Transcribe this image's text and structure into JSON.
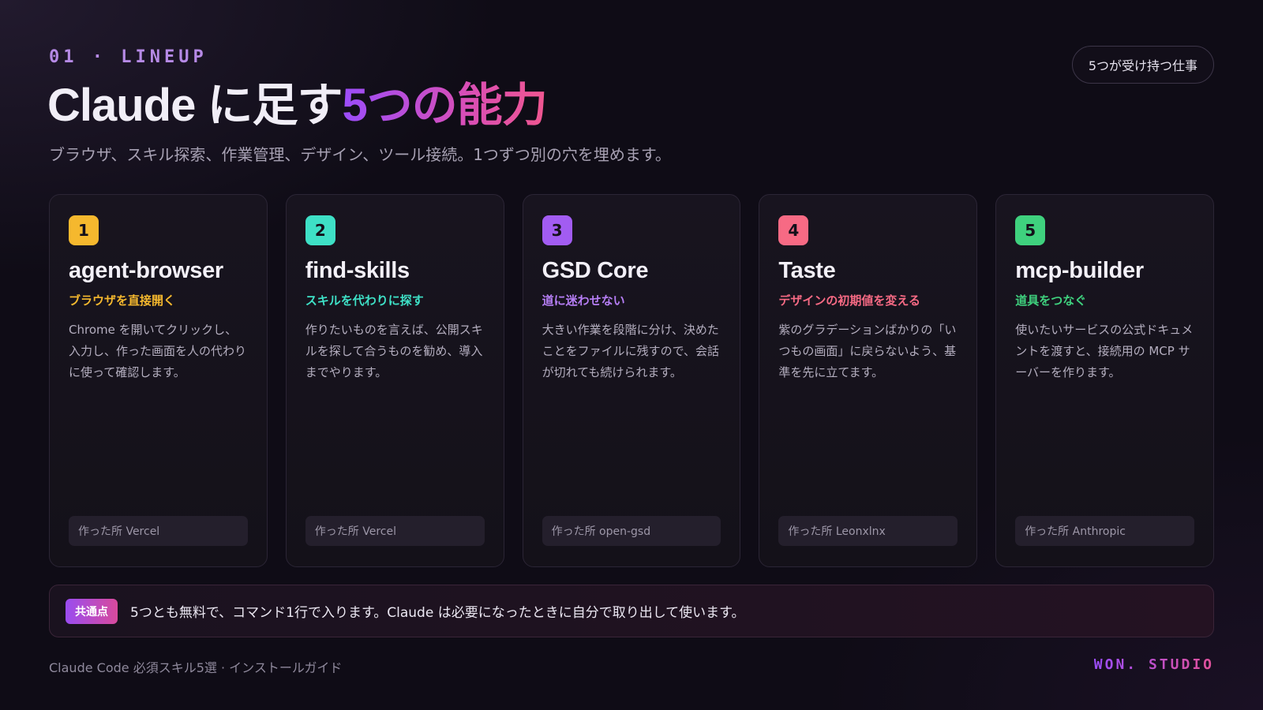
{
  "header": {
    "eyebrow": "01 · LINEUP",
    "title_plain": "Claude に足す",
    "title_accent": "5つの能力",
    "subtitle": "ブラウザ、スキル探索、作業管理、デザイン、ツール接続。1つずつ別の穴を埋めます。",
    "pill": "5つが受け持つ仕事"
  },
  "cards": [
    {
      "num": "1",
      "title": "agent-browser",
      "tag": "ブラウザを直接開く",
      "desc": "Chrome を開いてクリックし、入力し、作った画面を人の代わりに使って確認します。",
      "maker": "作った所 Vercel",
      "color": "#f5b82e"
    },
    {
      "num": "2",
      "title": "find-skills",
      "tag": "スキルを代わりに探す",
      "desc": "作りたいものを言えば、公開スキルを探して合うものを勧め、導入までやります。",
      "maker": "作った所 Vercel",
      "color": "#3ee0c6"
    },
    {
      "num": "3",
      "title": "GSD Core",
      "tag": "道に迷わせない",
      "desc": "大きい作業を段階に分け、決めたことをファイルに残すので、会話が切れても続けられます。",
      "maker": "作った所 open-gsd",
      "color": "#a25cf2"
    },
    {
      "num": "4",
      "title": "Taste",
      "tag": "デザインの初期値を変える",
      "desc": "紫のグラデーションばかりの「いつもの画面」に戻らないよう、基準を先に立てます。",
      "maker": "作った所 Leonxlnx",
      "color": "#f76a84"
    },
    {
      "num": "5",
      "title": "mcp-builder",
      "tag": "道具をつなぐ",
      "desc": "使いたいサービスの公式ドキュメントを渡すと、接続用の MCP サーバーを作ります。",
      "maker": "作った所 Anthropic",
      "color": "#3fd17e"
    }
  ],
  "common": {
    "badge": "共通点",
    "text": "5つとも無料で、コマンド1行で入ります。Claude は必要になったときに自分で取り出して使います。"
  },
  "footer": {
    "left": "Claude Code 必須スキル5選 · インストールガイド",
    "brand": "WON. STUDIO"
  },
  "colors": {
    "accent_purple": "#9b4dfa",
    "accent_pink": "#e2519a",
    "background": "#0f0c16"
  }
}
